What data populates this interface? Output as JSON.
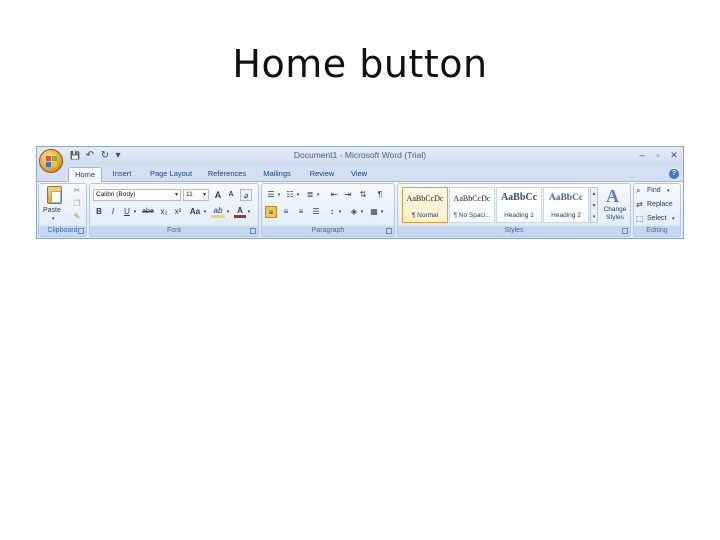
{
  "slide": {
    "title": "Home button"
  },
  "window": {
    "title": "Document1 - Microsoft Word (Trial)",
    "controls": {
      "minimize": "–",
      "maximize": "▫",
      "close": "✕"
    }
  },
  "quick_access": {
    "save": "💾",
    "undo": "↶",
    "redo": "↻",
    "customize": "▾"
  },
  "tabs": [
    "Home",
    "Insert",
    "Page Layout",
    "References",
    "Mailings",
    "Review",
    "View"
  ],
  "active_tab": "Home",
  "help": "?",
  "ribbon": {
    "clipboard": {
      "label": "Clipboard",
      "paste": "Paste",
      "paste_arrow": "▾"
    },
    "font": {
      "label": "Font",
      "font_name": "Calibri (Body)",
      "font_size": "11",
      "grow": "A",
      "shrink": "A",
      "clear": "ꬿ",
      "bold": "B",
      "italic": "I",
      "underline": "U",
      "strike": "abe",
      "subscript": "x₂",
      "superscript": "x²",
      "change_case": "Aa",
      "highlight": "ab",
      "font_color": "A"
    },
    "paragraph": {
      "label": "Paragraph"
    },
    "styles": {
      "label": "Styles",
      "items": [
        {
          "sample": "AaBbCcDc",
          "name": "¶ Normal"
        },
        {
          "sample": "AaBbCcDc",
          "name": "¶ No Spaci..."
        },
        {
          "sample": "AaBbCc",
          "name": "Heading 1"
        },
        {
          "sample": "AaBbCc",
          "name": "Heading 2"
        }
      ],
      "change_styles": "Change Styles"
    },
    "editing": {
      "label": "Editing",
      "find": "Find",
      "replace": "Replace",
      "select": "Select"
    }
  },
  "colors": {
    "accent": "#15428b",
    "ribbon": "#dbe6f5",
    "highlight": "#f7d64a",
    "font_color": "#c0262b"
  }
}
